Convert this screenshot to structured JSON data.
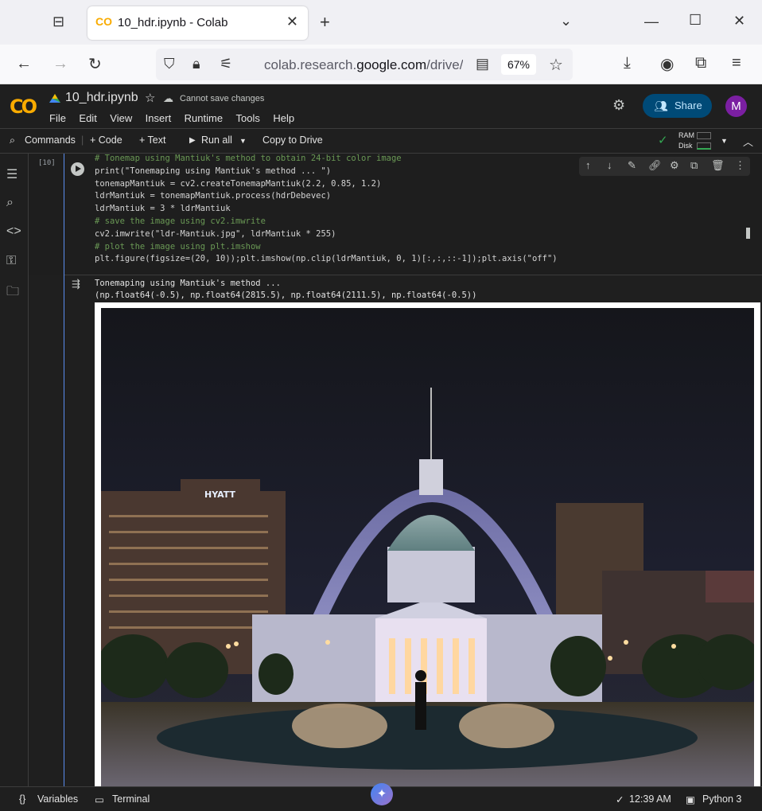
{
  "browser": {
    "tab_title": "10_hdr.ipynb - Colab",
    "tab_favicon": "CO",
    "url_domain": "colab.research.google.com",
    "url_path": "/drive/",
    "url_prefix": "colab.research.",
    "url_main": "google.com",
    "zoom": "67%"
  },
  "colab": {
    "logo": "CO",
    "notebook_name": "10_hdr.ipynb",
    "cannot_save": "Cannot save changes",
    "menu": [
      "File",
      "Edit",
      "View",
      "Insert",
      "Runtime",
      "Tools",
      "Help"
    ],
    "share_label": "Share",
    "avatar_letter": "M",
    "brand_color": "#f9ab00"
  },
  "toolbar": {
    "commands": "Commands",
    "code": "+ Code",
    "text": "+ Text",
    "run_all": "Run all",
    "copy_to_drive": "Copy to Drive",
    "ram": "RAM",
    "disk": "Disk"
  },
  "cell": {
    "exec_count": "[10]",
    "code_lines": [
      "# Tonemap using Mantiuk's method to obtain 24-bit color image",
      "print(\"Tonemaping using Mantiuk's method ... \")",
      "tonemapMantiuk = cv2.createTonemapMantiuk(2.2, 0.85, 1.2)",
      "ldrMantiuk = tonemapMantiuk.process(hdrDebevec)",
      "ldrMantiuk = 3 * ldrMantiuk",
      "# save the image using cv2.imwrite",
      "cv2.imwrite(\"ldr-Mantiuk.jpg\", ldrMantiuk * 255)",
      "# plot the image using plt.imshow",
      "plt.figure(figsize=(20, 10));plt.imshow(np.clip(ldrMantiuk, 0, 1)[:,:,::-1]);plt.axis(\"off\")"
    ]
  },
  "output": {
    "lines": [
      "Tonemaping using Mantiuk's method ...",
      "(np.float64(-0.5), np.float64(2815.5), np.float64(2111.5), np.float64(-0.5))"
    ],
    "image_sign": "HYATT"
  },
  "status": {
    "variables": "Variables",
    "terminal": "Terminal",
    "time": "12:39 AM",
    "runtime": "Python 3"
  }
}
